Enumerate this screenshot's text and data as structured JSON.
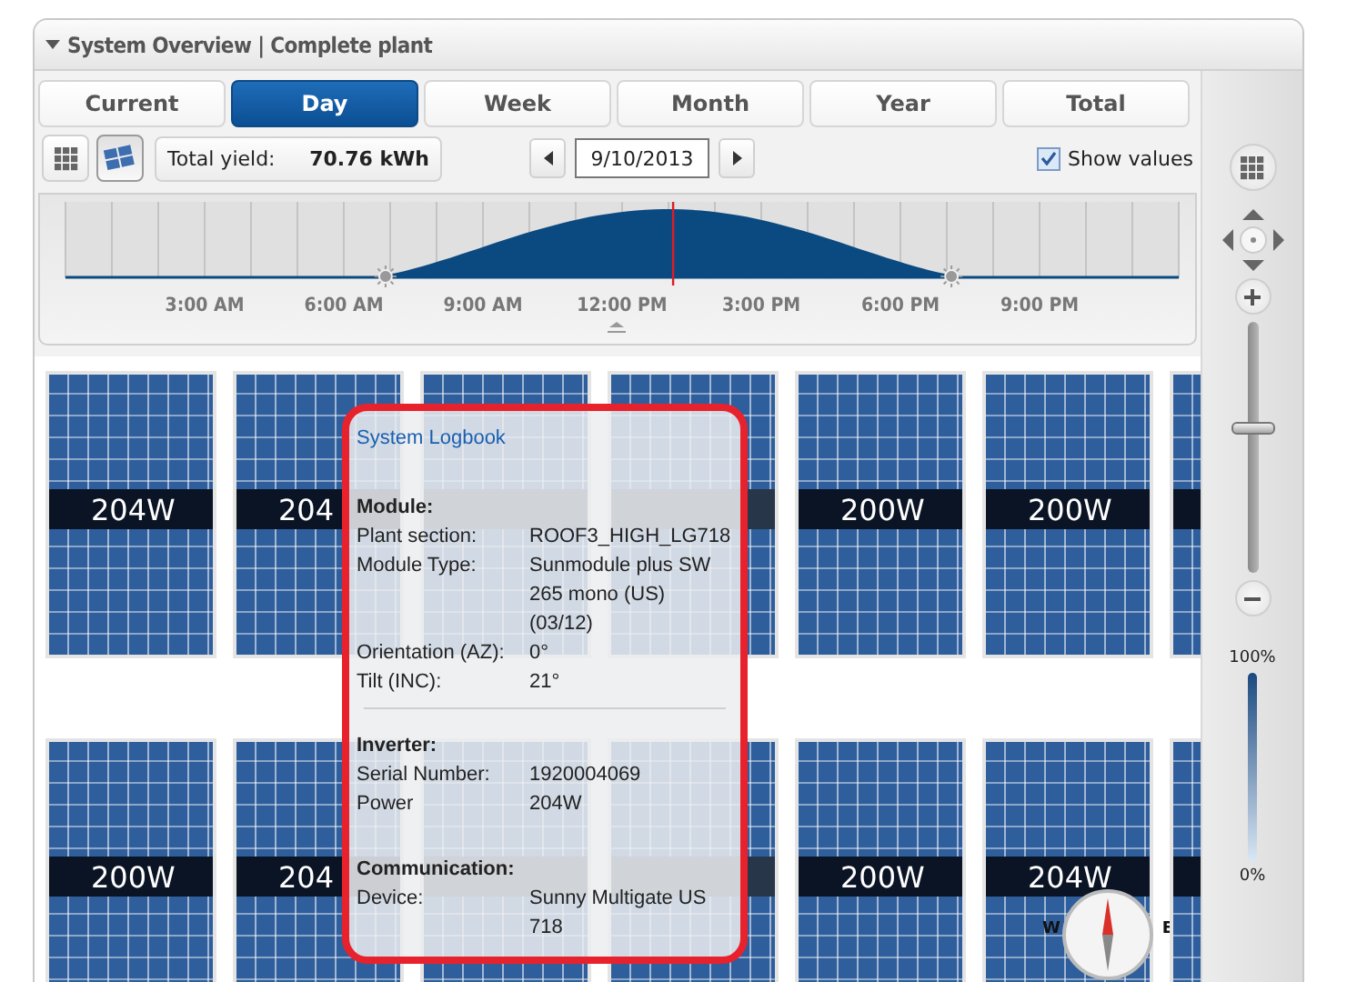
{
  "window": {
    "title": "System Overview | Complete plant"
  },
  "tabs": [
    {
      "label": "Current",
      "selected": false
    },
    {
      "label": "Day",
      "selected": true
    },
    {
      "label": "Week",
      "selected": false
    },
    {
      "label": "Month",
      "selected": false
    },
    {
      "label": "Year",
      "selected": false
    },
    {
      "label": "Total",
      "selected": false
    }
  ],
  "toolbar": {
    "view_buttons": [
      {
        "kind": "grid",
        "selected": false
      },
      {
        "kind": "panels",
        "selected": true
      }
    ],
    "yield_label": "Total yield:",
    "yield_value": "70.76 kWh",
    "date": "9/10/2013",
    "show_values": {
      "label": "Show values",
      "checked": true
    }
  },
  "timeline": {
    "xlabels": [
      "3:00 AM",
      "6:00 AM",
      "9:00 AM",
      "12:00 PM",
      "3:00 PM",
      "6:00 PM",
      "9:00 PM"
    ]
  },
  "modules": [
    {
      "before_tooltip": [
        "204W",
        "204"
      ],
      "after_tooltip": [
        "200W",
        "200W"
      ]
    },
    {
      "before_tooltip": [
        "200W",
        "204"
      ],
      "after_tooltip": [
        "200W",
        "204W"
      ]
    }
  ],
  "tooltip": {
    "link": "System Logbook",
    "sections": [
      {
        "title": "Module:",
        "rows": [
          {
            "label": "Plant section:",
            "value": "ROOF3_HIGH_LG718"
          },
          {
            "label": "Module Type:",
            "value": "Sunmodule plus SW 265 mono (US) (03/12)"
          },
          {
            "label": "Orientation (AZ):",
            "value": "0°"
          },
          {
            "label": "Tilt (INC):",
            "value": "21°"
          }
        ]
      },
      {
        "title": "Inverter:",
        "rows": [
          {
            "label": "Serial Number:",
            "value": "1920004069"
          },
          {
            "label": "Power",
            "value": "204W"
          }
        ]
      },
      {
        "title": "Communication:",
        "rows": [
          {
            "label": "Device:",
            "value": "Sunny Multigate US 718"
          }
        ]
      }
    ]
  },
  "compass": {
    "west": "W",
    "east": "E"
  },
  "zoom": {
    "level": 0.58,
    "max_label": "100%",
    "min_label": "0%"
  }
}
